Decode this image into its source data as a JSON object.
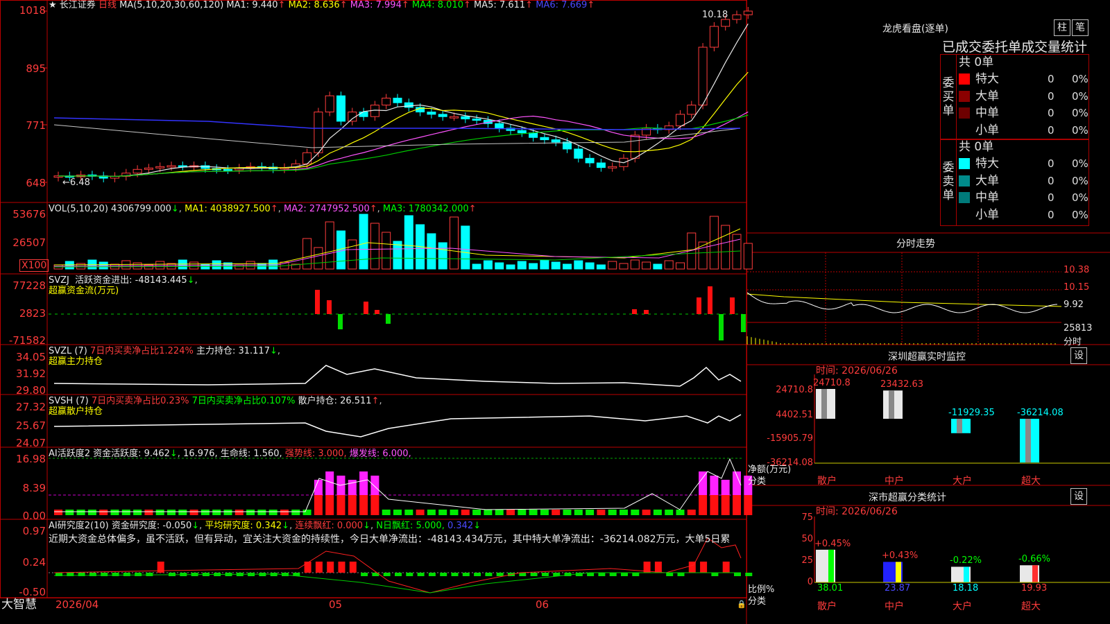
{
  "stock": {
    "star_icon": "star-icon",
    "name": "长江证券",
    "period": "日线",
    "last_label": "10.18",
    "low_label": "←6.48"
  },
  "ma_header": {
    "prefix": "MA(5,10,20,30,60,120)",
    "items": [
      {
        "text": "MA1: 9.440",
        "color": "#e8e8e8"
      },
      {
        "text": "MA2: 8.636",
        "color": "#ffff00"
      },
      {
        "text": "MA3: 7.994",
        "color": "#ff55ff"
      },
      {
        "text": "MA4: 8.010",
        "color": "#00ff00"
      },
      {
        "text": "MA5: 7.611",
        "color": "#e8e8e8"
      },
      {
        "text": "MA6: 7.669",
        "color": "#4a4aff"
      }
    ]
  },
  "price_axis": [
    "1018",
    "895",
    "771",
    "648"
  ],
  "vol": {
    "header": "VOL(5,10,20)",
    "value": "4306799.000",
    "ma1": "MA1: 4038927.500",
    "ma2": "MA2: 2747952.500",
    "ma3": "MA3: 1780342.000",
    "axis": [
      "53676",
      "26507"
    ],
    "unit": "X100"
  },
  "svzj": {
    "name": "SVZJ",
    "line1": "活跃资金进出: -48143.445",
    "line2": "超赢资金流(万元)",
    "axis": [
      "77228",
      "2823",
      "-71582"
    ]
  },
  "svzl": {
    "name": "SVZL (7)",
    "a": "7日内买卖净占比1.224%",
    "b": "主力持仓: 31.117",
    "line2": "超赢主力持仓",
    "axis": [
      "34.05",
      "31.92",
      "29.80"
    ]
  },
  "svsh": {
    "name": "SVSH (7)",
    "a": "7日内买卖净占比0.23%",
    "b": "7日内买卖净占比0.107%",
    "c": "散户持仓: 26.511",
    "line2": "超赢散户持仓",
    "axis": [
      "27.32",
      "25.67",
      "24.07"
    ]
  },
  "ai_act": {
    "name": "AI活跃度2",
    "a": "资金活跃度: 9.462",
    "b": "16.976,",
    "c": "生命线: 1.560,",
    "d": "强势线: 3.000,",
    "e": "爆发线: 6.000,",
    "axis": [
      "16.98",
      "8.39",
      "0.00"
    ]
  },
  "ai_res": {
    "name": "AI研究度2(10)",
    "a": "资金研究度: -0.050",
    "b": "平均研究度: 0.342",
    "c": "连续飘红: 0.000",
    "d": "N日飘红: 5.000,",
    "e": "0.342",
    "comment": "近期大资金总体偏多，虽不活跃，但有异动，宜关注大资金的持续性，今日大单净流出：-48143.434万元，其中特大单净流出：-36214.082万元，大单5日累",
    "axis": [
      "0.97",
      "0.24",
      "-0.50"
    ]
  },
  "bottom_axis": {
    "brand": "大智慧",
    "start": "2026/04",
    "m1": "05",
    "m2": "06"
  },
  "lhb": {
    "title": "龙虎看盘(逐单)",
    "btn_a": "柱",
    "btn_b": "笔",
    "subtitle": "已成交委托单成交量统计",
    "buy": {
      "label": [
        "委",
        "买",
        "单"
      ],
      "total": "共 0单",
      "rows": [
        {
          "name": "特大",
          "n": "0",
          "p": "0%",
          "color": "#ff0000"
        },
        {
          "name": "大单",
          "n": "0",
          "p": "0%",
          "color": "#8b0000"
        },
        {
          "name": "中单",
          "n": "0",
          "p": "0%",
          "color": "#6e0000"
        },
        {
          "name": "小单",
          "n": "0",
          "p": "0%",
          "color": ""
        }
      ]
    },
    "sell": {
      "label": [
        "委",
        "卖",
        "单"
      ],
      "total": "共 0单",
      "rows": [
        {
          "name": "特大",
          "n": "0",
          "p": "0%",
          "color": "#00ffff"
        },
        {
          "name": "大单",
          "n": "0",
          "p": "0%",
          "color": "#008b8b"
        },
        {
          "name": "中单",
          "n": "0",
          "p": "0%",
          "color": "#007a7a"
        },
        {
          "name": "小单",
          "n": "0",
          "p": "0%",
          "color": ""
        }
      ]
    }
  },
  "intraday": {
    "title": "分时走势",
    "axis": [
      "10.38",
      "10.15",
      "9.92",
      "25813",
      "分时"
    ]
  },
  "sz_monitor": {
    "title": "深圳超赢实时监控",
    "set_btn": "设",
    "time": "时间: 2026/06/26",
    "axis": [
      "24710.8",
      "4402.51",
      "-15905.79",
      "-36214.08"
    ],
    "ylabel": "净额(万元)",
    "xcap": "分类",
    "bars": [
      {
        "cat": "散户",
        "value": 24710.8,
        "label": "24710.8"
      },
      {
        "cat": "中户",
        "value": 23432.63,
        "label": "23432.63"
      },
      {
        "cat": "大户",
        "value": -11929.35,
        "label": "-11929.35"
      },
      {
        "cat": "超大",
        "value": -36214.08,
        "label": "-36214.08"
      }
    ]
  },
  "sz_class": {
    "title": "深市超赢分类统计",
    "set_btn": "设",
    "time": "时间: 2026/06/26",
    "axis": [
      "75",
      "50",
      "25",
      "0"
    ],
    "ylabel": "比例%",
    "xcap": "分类",
    "bars": [
      {
        "cat": "散户",
        "value": 38.01,
        "label": "38.01",
        "chg": "+0.45%"
      },
      {
        "cat": "中户",
        "value": 23.87,
        "label": "23.87",
        "chg": "+0.43%"
      },
      {
        "cat": "大户",
        "value": 18.18,
        "label": "18.18",
        "chg": "-0.22%"
      },
      {
        "cat": "超大",
        "value": 19.93,
        "label": "19.93",
        "chg": "-0.66%"
      }
    ]
  }
}
